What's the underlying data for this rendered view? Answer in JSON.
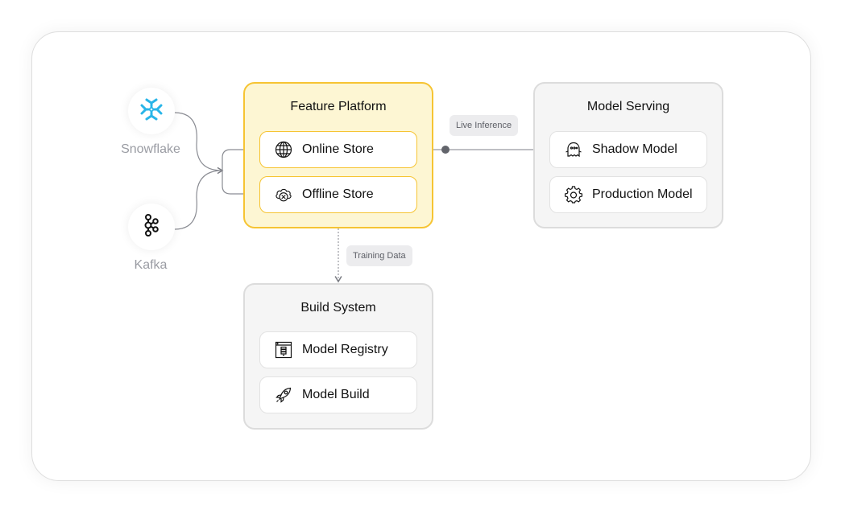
{
  "colors": {
    "accent_yellow": "#f6c433",
    "yellow_fill": "#fdf6d3",
    "gray_fill": "#f5f5f5",
    "connector_blue": "#2f8ff0",
    "connector_gray": "#62646b",
    "snowflake_blue": "#29b5e8"
  },
  "sources": [
    {
      "label": "Snowflake",
      "icon": "snowflake-icon"
    },
    {
      "label": "Kafka",
      "icon": "kafka-icon"
    }
  ],
  "feature_platform": {
    "title": "Feature Platform",
    "items": [
      {
        "label": "Online Store",
        "icon": "globe-icon"
      },
      {
        "label": "Offline Store",
        "icon": "cloud-x-icon"
      }
    ]
  },
  "model_serving": {
    "title": "Model Serving",
    "items": [
      {
        "label": "Shadow Model",
        "icon": "ghost-icon"
      },
      {
        "label": "Production Model",
        "icon": "gear-icon"
      }
    ]
  },
  "build_system": {
    "title": "Build System",
    "items": [
      {
        "label": "Model Registry",
        "icon": "registry-icon"
      },
      {
        "label": "Model Build",
        "icon": "rocket-icon"
      }
    ]
  },
  "edges": {
    "live_inference": "Live Inference",
    "training_data": "Training Data"
  }
}
